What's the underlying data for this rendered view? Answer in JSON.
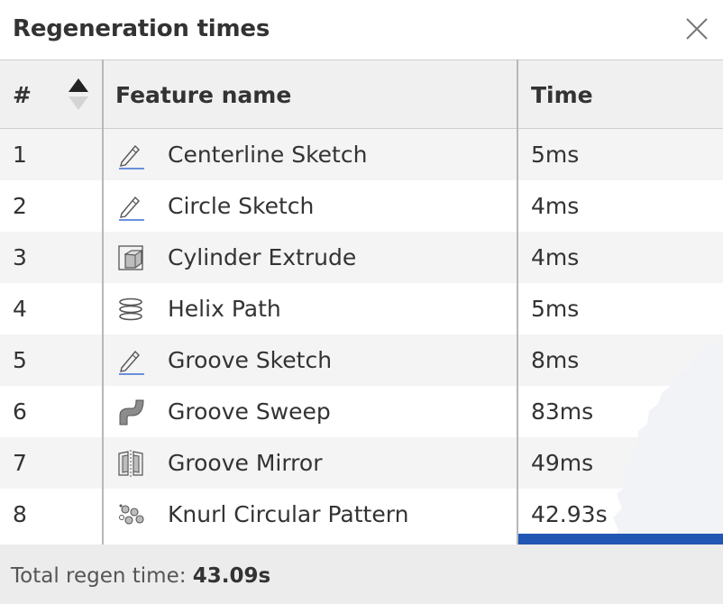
{
  "dialog": {
    "title": "Regeneration times",
    "close_icon": "close-icon"
  },
  "table": {
    "headers": {
      "number": "#",
      "feature_name": "Feature name",
      "time": "Time"
    },
    "sort_icon": "sort-ascending-icon",
    "rows": [
      {
        "num": "1",
        "icon": "sketch-pencil-icon",
        "name": "Centerline Sketch",
        "time": "5ms"
      },
      {
        "num": "2",
        "icon": "sketch-pencil-icon",
        "name": "Circle Sketch",
        "time": "4ms"
      },
      {
        "num": "3",
        "icon": "extrude-icon",
        "name": "Cylinder Extrude",
        "time": "4ms"
      },
      {
        "num": "4",
        "icon": "helix-icon",
        "name": "Helix Path",
        "time": "5ms"
      },
      {
        "num": "5",
        "icon": "sketch-pencil-icon",
        "name": "Groove Sketch",
        "time": "8ms"
      },
      {
        "num": "6",
        "icon": "sweep-icon",
        "name": "Groove Sweep",
        "time": "83ms"
      },
      {
        "num": "7",
        "icon": "mirror-icon",
        "name": "Groove Mirror",
        "time": "49ms"
      },
      {
        "num": "8",
        "icon": "circular-pattern-icon",
        "name": "Knurl Circular Pattern",
        "time": "42.93s"
      }
    ],
    "time_bar_color": "#2156b3"
  },
  "footer": {
    "label": "Total regen time:",
    "value": "43.09s"
  }
}
